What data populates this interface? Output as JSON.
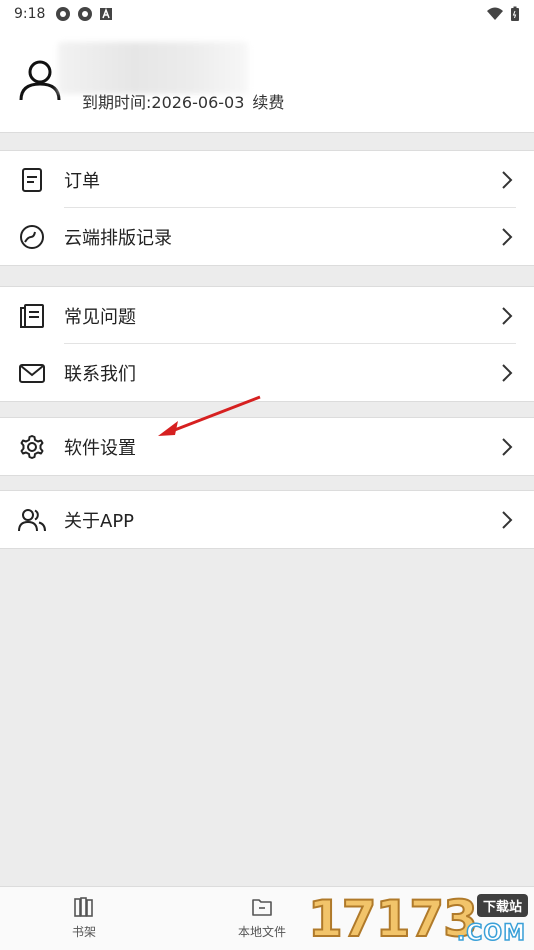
{
  "status_bar": {
    "time": "9:18"
  },
  "profile": {
    "expiry_text": "到期时间:2026-06-03",
    "renew_label": "续费"
  },
  "groups": [
    {
      "items": [
        {
          "label": "订单",
          "icon": "order-icon"
        },
        {
          "label": "云端排版记录",
          "icon": "cloud-history-icon"
        }
      ]
    },
    {
      "items": [
        {
          "label": "常见问题",
          "icon": "faq-icon"
        },
        {
          "label": "联系我们",
          "icon": "mail-icon"
        }
      ]
    },
    {
      "items": [
        {
          "label": "软件设置",
          "icon": "gear-icon"
        }
      ]
    },
    {
      "items": [
        {
          "label": "关于APP",
          "icon": "users-icon"
        }
      ]
    }
  ],
  "bottom_nav": {
    "items": [
      {
        "label": "书架",
        "icon": "bookshelf-icon"
      },
      {
        "label": "本地文件",
        "icon": "folder-icon"
      }
    ]
  },
  "watermark": {
    "number": "17173",
    "badge": "下载站",
    "domain": ".COM"
  },
  "colors": {
    "annotation_arrow": "#d62020",
    "background": "#ececec"
  }
}
